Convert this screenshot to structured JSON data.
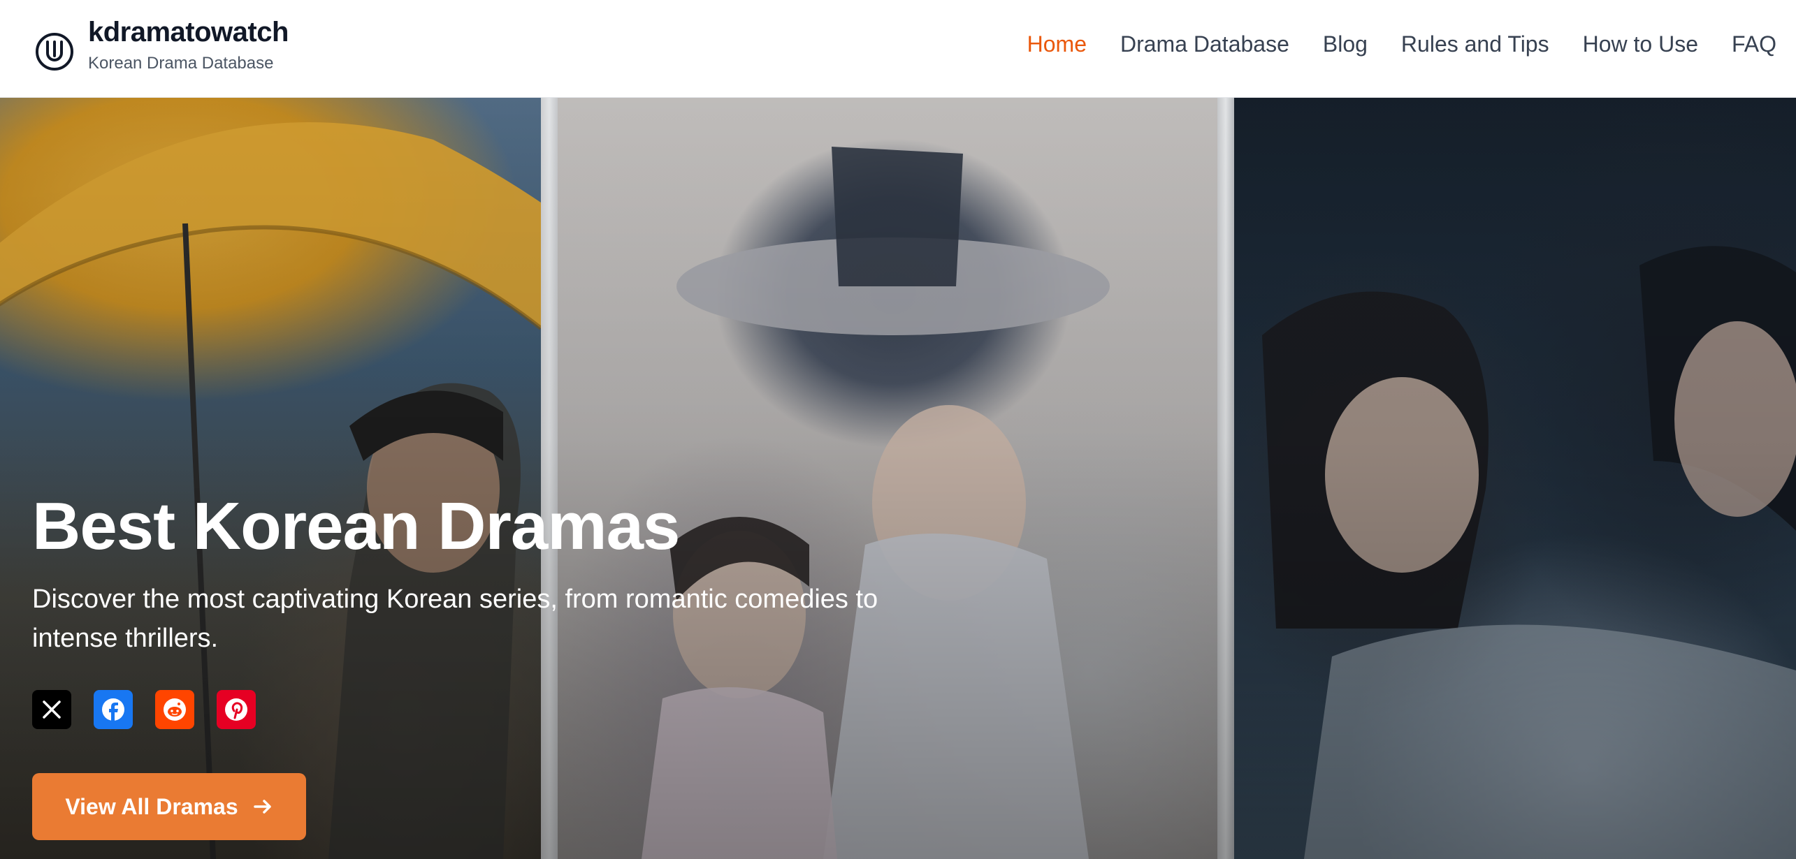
{
  "header": {
    "brand_name": "kdramatowatch",
    "brand_tagline": "Korean Drama Database",
    "logo_icon": "smile-circle-icon",
    "nav": [
      {
        "label": "Home",
        "active": true
      },
      {
        "label": "Drama Database",
        "active": false
      },
      {
        "label": "Blog",
        "active": false
      },
      {
        "label": "Rules and Tips",
        "active": false
      },
      {
        "label": "How to Use",
        "active": false
      },
      {
        "label": "FAQ",
        "active": false
      }
    ]
  },
  "hero": {
    "title": "Best Korean Dramas",
    "subtitle": "Discover the most captivating Korean series, from romantic comedies to intense thrillers.",
    "share": [
      {
        "network": "X",
        "icon": "x-logo-icon",
        "color": "#000000"
      },
      {
        "network": "Facebook",
        "icon": "facebook-icon",
        "color": "#1877f2"
      },
      {
        "network": "Reddit",
        "icon": "reddit-icon",
        "color": "#ff4500"
      },
      {
        "network": "Pinterest",
        "icon": "pinterest-icon",
        "color": "#e60023"
      }
    ],
    "cta_label": "View All Dramas",
    "cta_icon": "arrow-right-icon"
  },
  "colors": {
    "accent": "#ea580c",
    "cta": "#ea7b33",
    "text_dark": "#111827"
  }
}
